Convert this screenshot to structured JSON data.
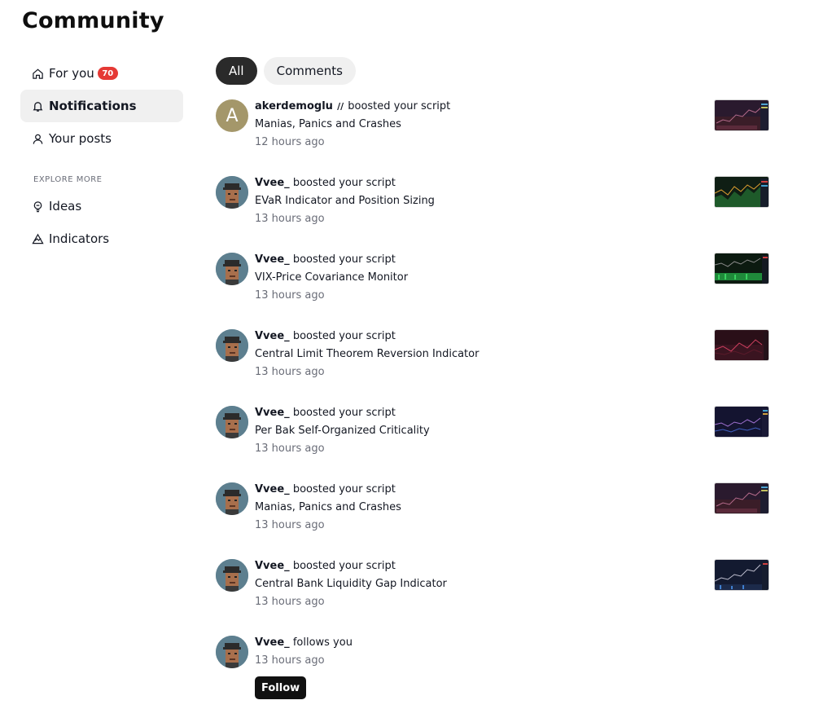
{
  "page": {
    "title": "Community"
  },
  "sidebar": {
    "items": [
      {
        "label": "For you",
        "icon": "home-icon",
        "badge": "70"
      },
      {
        "label": "Notifications",
        "icon": "bell-icon"
      },
      {
        "label": "Your posts",
        "icon": "user-icon"
      }
    ],
    "explore_label": "EXPLORE MORE",
    "explore_items": [
      {
        "label": "Ideas",
        "icon": "lightbulb-icon"
      },
      {
        "label": "Indicators",
        "icon": "indicator-icon"
      }
    ]
  },
  "tabs": [
    {
      "label": "All"
    },
    {
      "label": "Comments"
    }
  ],
  "notifications": [
    {
      "user": "akerdemoglu",
      "avatar_letter": "A",
      "action": "boosted your script",
      "title": "Manias, Panics and Crashes",
      "time": "12 hours ago",
      "thumb_color": "#2a1a2e"
    },
    {
      "user": "Vvee_",
      "action": "boosted your script",
      "title": "EVaR Indicator and Position Sizing",
      "time": "13 hours ago",
      "thumb_color": "#0f1e14"
    },
    {
      "user": "Vvee_",
      "action": "boosted your script",
      "title": "VIX-Price Covariance Monitor",
      "time": "13 hours ago",
      "thumb_color": "#0c1a10"
    },
    {
      "user": "Vvee_",
      "action": "boosted your script",
      "title": "Central Limit Theorem Reversion Indicator",
      "time": "13 hours ago",
      "thumb_color": "#2a0f18"
    },
    {
      "user": "Vvee_",
      "action": "boosted your script",
      "title": "Per Bak Self-Organized Criticality",
      "time": "13 hours ago",
      "thumb_color": "#141430"
    },
    {
      "user": "Vvee_",
      "action": "boosted your script",
      "title": "Manias, Panics and Crashes",
      "time": "13 hours ago",
      "thumb_color": "#2a1a2e"
    },
    {
      "user": "Vvee_",
      "action": "boosted your script",
      "title": "Central Bank Liquidity Gap Indicator",
      "time": "13 hours ago",
      "thumb_color": "#131a30"
    }
  ],
  "follow_notification": {
    "user": "Vvee_",
    "action": "follows you",
    "time": "13 hours ago",
    "button": "Follow"
  }
}
